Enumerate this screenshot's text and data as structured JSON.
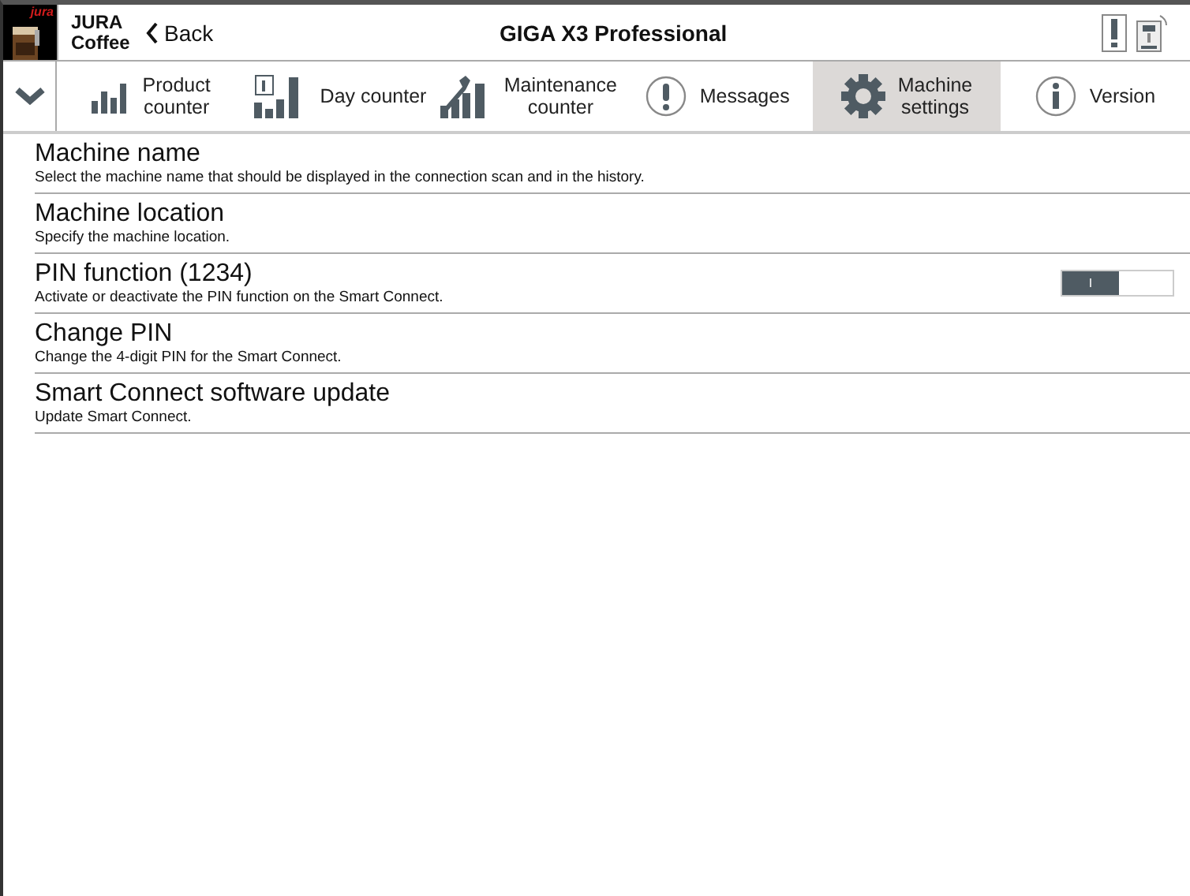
{
  "header": {
    "logo_text": "jura",
    "app_name": [
      "JURA",
      "Coffee"
    ],
    "back": "Back",
    "title": "GIGA X3 Professional"
  },
  "tabs": [
    {
      "kind": "product",
      "label": [
        "Product",
        "counter"
      ],
      "selected": false
    },
    {
      "kind": "day",
      "label": [
        "Day counter"
      ],
      "selected": false
    },
    {
      "kind": "maintenance",
      "label": [
        "Maintenance",
        "counter"
      ],
      "selected": false
    },
    {
      "kind": "messages",
      "label": [
        "Messages"
      ],
      "selected": false
    },
    {
      "kind": "settings",
      "label": [
        "Machine",
        "settings"
      ],
      "selected": true
    },
    {
      "kind": "version",
      "label": [
        "Version"
      ],
      "selected": false
    }
  ],
  "settings": [
    {
      "title": "Machine name",
      "description": "Select the machine name that should be displayed in the connection scan and in the history."
    },
    {
      "title": "Machine location",
      "description": "Specify the machine location."
    },
    {
      "title": "PIN function (1234)",
      "description": "Activate or deactivate the PIN function on the Smart Connect.",
      "toggle": {
        "on": true,
        "on_label": "I"
      }
    },
    {
      "title": "Change PIN",
      "description": "Change the 4-digit PIN for the Smart Connect."
    },
    {
      "title": "Smart Connect software update",
      "description": "Update Smart Connect."
    }
  ]
}
